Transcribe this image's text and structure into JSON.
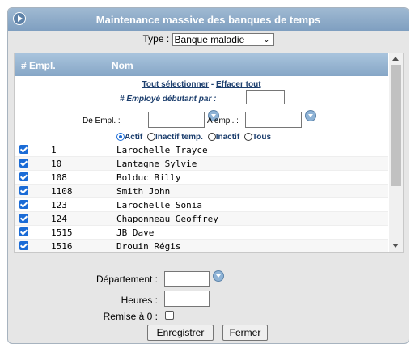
{
  "window": {
    "title": "Maintenance massive des banques de temps"
  },
  "type_filter": {
    "label": "Type :",
    "selected": "Banque maladie"
  },
  "list": {
    "headers": {
      "empl": "# Empl.",
      "name": "Nom"
    },
    "select_all": "Tout sélectionner",
    "separator": " - ",
    "clear_all": "Effacer tout",
    "starts_with_label": "# Employé débutant par :",
    "from_label": "De Empl. :",
    "to_label": "A empl. :",
    "status_options": [
      "Actif",
      "Inactif temp.",
      "Inactif",
      "Tous"
    ],
    "rows": [
      {
        "num": "1",
        "name": "Larochelle Trayce"
      },
      {
        "num": "10",
        "name": "Lantagne Sylvie"
      },
      {
        "num": "108",
        "name": "Bolduc Billy"
      },
      {
        "num": "1108",
        "name": "Smith John"
      },
      {
        "num": "123",
        "name": "Larochelle Sonia"
      },
      {
        "num": "124",
        "name": "Chaponneau Geoffrey"
      },
      {
        "num": "1515",
        "name": "JB Dave"
      },
      {
        "num": "1516",
        "name": "Drouin Régis"
      }
    ]
  },
  "form": {
    "department_label": "Département :",
    "hours_label": "Heures :",
    "reset_label": "Remise à 0 :",
    "save_button": "Enregistrer",
    "close_button": "Fermer"
  }
}
